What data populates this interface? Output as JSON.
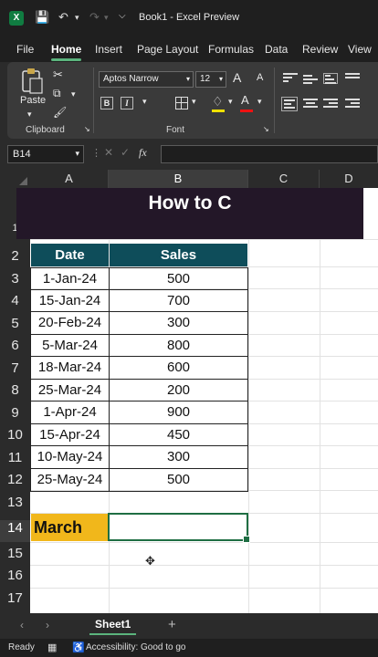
{
  "window": {
    "title": "Book1 - Excel Preview",
    "app_icon": "X"
  },
  "tabs": [
    "File",
    "Home",
    "Insert",
    "Page Layout",
    "Formulas",
    "Data",
    "Review",
    "View"
  ],
  "ribbon": {
    "paste_label": "Paste",
    "clipboard_label": "Clipboard",
    "font_label": "Font",
    "font_name": "Aptos Narrow",
    "font_size": "12",
    "bold": "B",
    "italic": "I",
    "grow_font": "A",
    "shrink_font": "A",
    "font_color_letter": "A"
  },
  "formula_bar": {
    "name_box": "B14",
    "fx": "fx",
    "value": ""
  },
  "columns": [
    "A",
    "B",
    "C",
    "D"
  ],
  "rows": [
    "1",
    "2",
    "3",
    "4",
    "5",
    "6",
    "7",
    "8",
    "9",
    "10",
    "11",
    "12",
    "13",
    "14",
    "15",
    "16",
    "17"
  ],
  "banner": "How to C",
  "table": {
    "headers": [
      "Date",
      "Sales"
    ],
    "rows": [
      [
        "1-Jan-24",
        "500"
      ],
      [
        "15-Jan-24",
        "700"
      ],
      [
        "20-Feb-24",
        "300"
      ],
      [
        "5-Mar-24",
        "800"
      ],
      [
        "18-Mar-24",
        "600"
      ],
      [
        "25-Mar-24",
        "200"
      ],
      [
        "1-Apr-24",
        "900"
      ],
      [
        "15-Apr-24",
        "450"
      ],
      [
        "10-May-24",
        "300"
      ],
      [
        "25-May-24",
        "500"
      ]
    ]
  },
  "label_cell": "March",
  "sheets": [
    "Sheet1"
  ],
  "status": {
    "ready": "Ready",
    "accessibility": "Accessibility: Good to go"
  },
  "colors": {
    "accent": "#107c41",
    "header_fill": "#0e4d5a",
    "banner_fill": "#231728",
    "label_fill": "#f1b71b"
  }
}
